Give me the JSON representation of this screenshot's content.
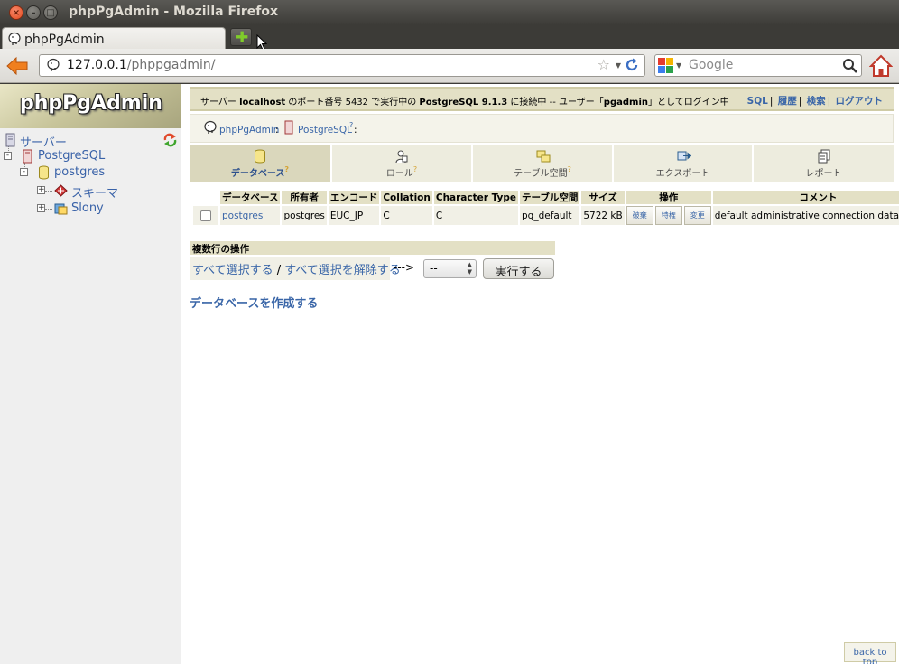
{
  "window": {
    "title": "phpPgAdmin - Mozilla Firefox"
  },
  "browser": {
    "tab_title": "phpPgAdmin",
    "url_host": "127.0.0.1",
    "url_path": "/phppgadmin/",
    "search_placeholder": "Google"
  },
  "sidebar": {
    "logo": "phpPgAdmin",
    "tree": {
      "servers": "サーバー",
      "server": "PostgreSQL",
      "database": "postgres",
      "schema": "スキーマ",
      "slony": "Slony"
    }
  },
  "topbar": {
    "prefix": "サーバー ",
    "host": "localhost",
    "mid1": " のポート番号 5432 で実行中の ",
    "product": "PostgreSQL 9.1.3",
    "mid2": " に接続中 -- ユーザー「",
    "user": "pgadmin",
    "suffix": "」としてログイン中",
    "links": {
      "sql": "SQL",
      "history": "履歴",
      "search": "検索",
      "logout": "ログアウト"
    }
  },
  "trail": {
    "root": "phpPgAdmin",
    "server": "PostgreSQL",
    "help_mark": "?",
    "tail": ":"
  },
  "tabs": [
    {
      "label": "データベース",
      "help": "?",
      "active": true
    },
    {
      "label": "ロール",
      "help": "?"
    },
    {
      "label": "テーブル空間",
      "help": "?"
    },
    {
      "label": "エクスポート"
    },
    {
      "label": "レポート"
    }
  ],
  "table": {
    "headers": {
      "database": "データベース",
      "owner": "所有者",
      "encoding": "エンコード",
      "collation": "Collation",
      "ctype": "Character Type",
      "tablespace": "テーブル空間",
      "size": "サイズ",
      "actions": "操作",
      "comment": "コメント"
    },
    "rows": [
      {
        "name": "postgres",
        "owner": "postgres",
        "encoding": "EUC_JP",
        "collation": "C",
        "ctype": "C",
        "tablespace": "pg_default",
        "size": "5722 kB",
        "drop": "破棄",
        "privileges": "特権",
        "alter": "変更",
        "comment": "default administrative connection database"
      }
    ]
  },
  "multi": {
    "header": "複数行の操作",
    "select_all": "すべて選択する",
    "slash": " / ",
    "unselect_all": "すべて選択を解除する",
    "arrow": "--->",
    "selected": "--",
    "execute": "実行する"
  },
  "create_db": "データベースを作成する",
  "back_to_top": "back to top",
  "colors": {
    "accent": "#3a66a8",
    "header_bg": "#e3e0c5",
    "row_bg": "#f1f0e6"
  }
}
